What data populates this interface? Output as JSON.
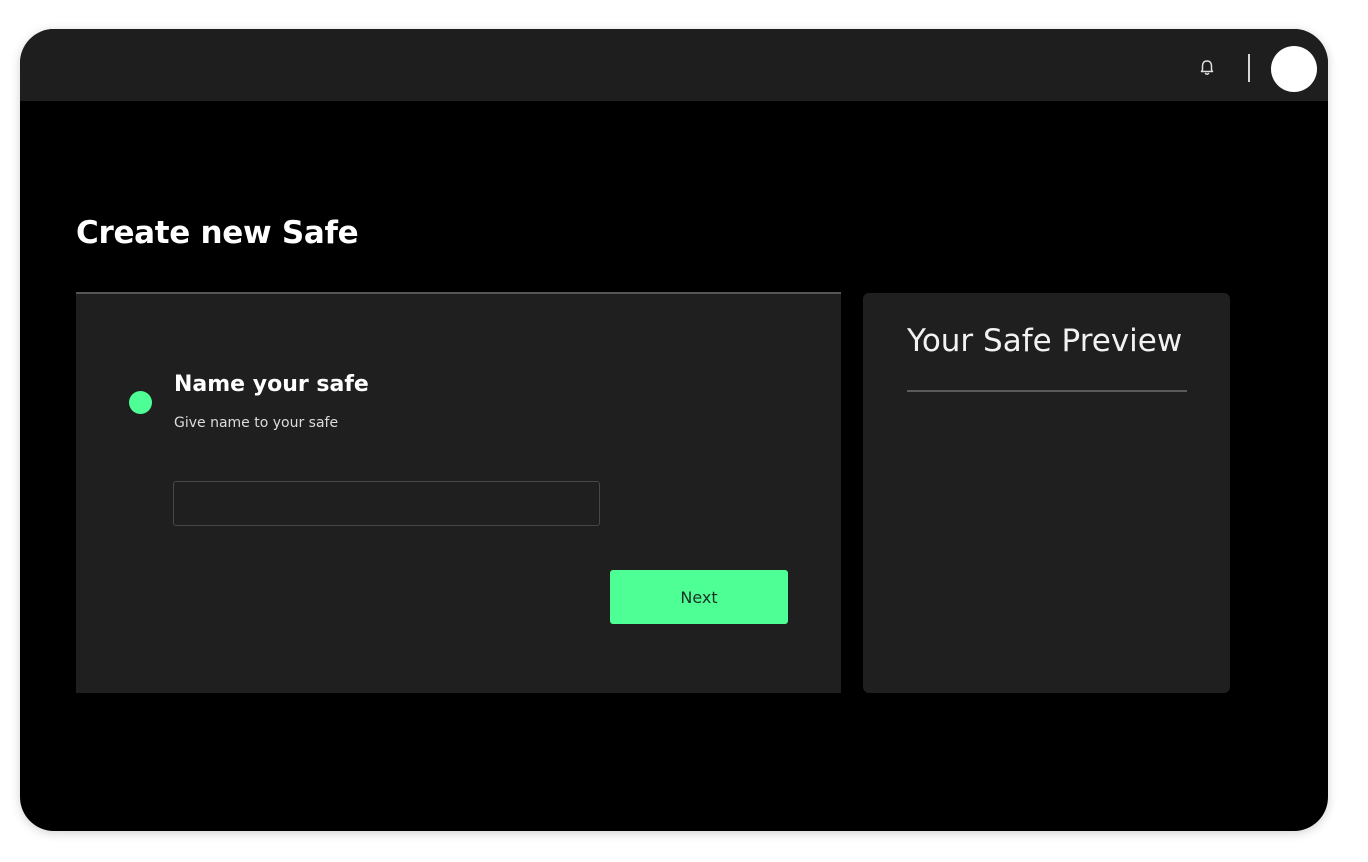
{
  "header": {
    "icons": [
      "bell-icon",
      "avatar"
    ]
  },
  "page": {
    "title": "Create new Safe"
  },
  "step": {
    "title": "Name your safe",
    "subtitle": "Give name to your safe",
    "input_value": "",
    "input_placeholder": "",
    "next_label": "Next",
    "status_color": "#4dff94"
  },
  "preview": {
    "title": "Your Safe Preview"
  },
  "colors": {
    "accent": "#4dff94",
    "background": "#000000",
    "card": "#1f1f1f",
    "topbar": "#1e1e1e"
  }
}
